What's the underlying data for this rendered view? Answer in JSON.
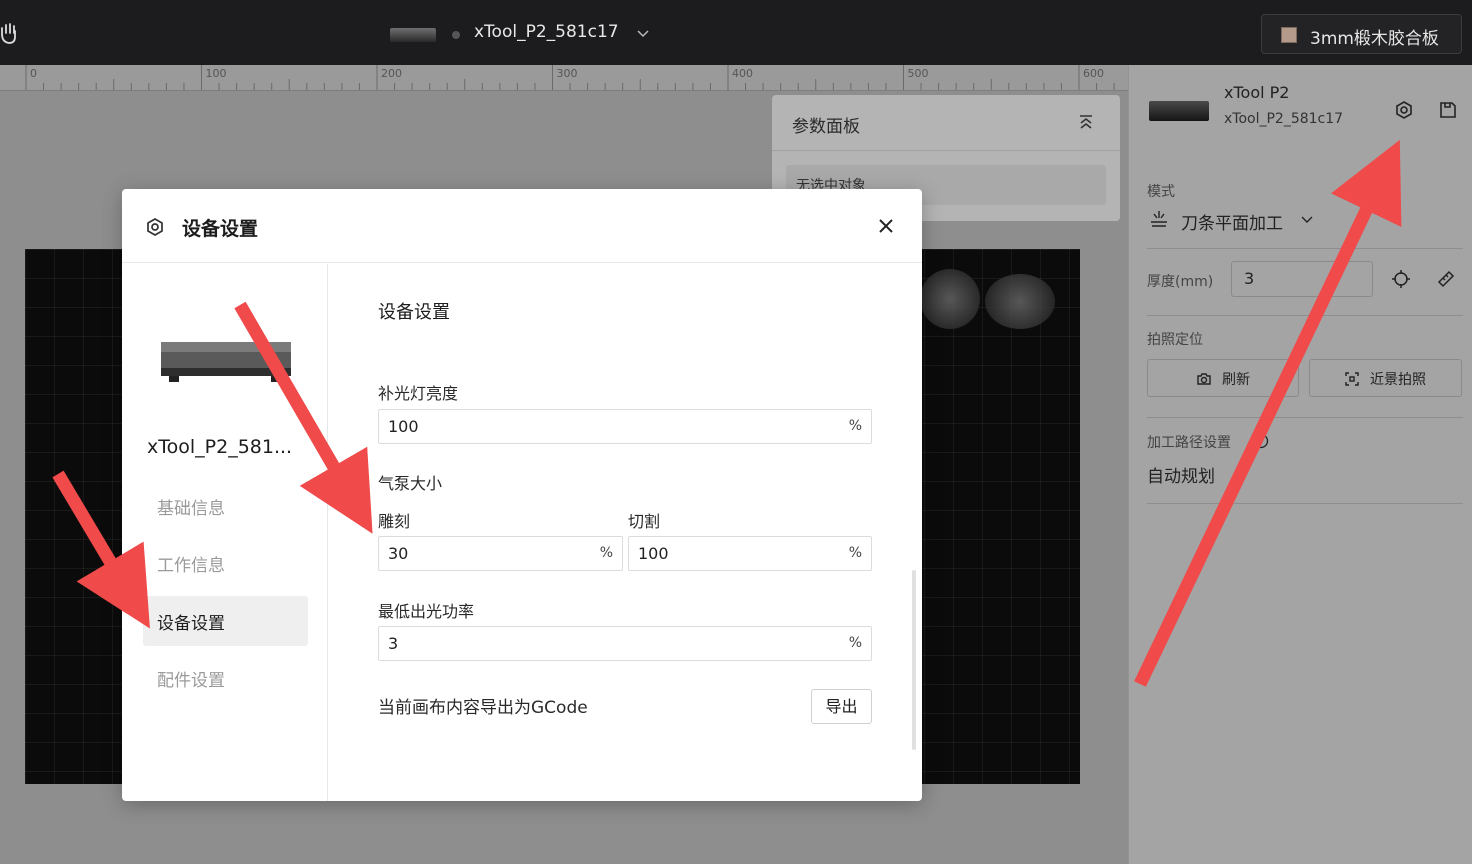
{
  "topbar": {
    "device_name": "xTool_P2_581c17",
    "material": "3mm椴木胶合板"
  },
  "ruler": {
    "ticks": [
      "0",
      "100",
      "200",
      "300",
      "400",
      "500",
      "600"
    ]
  },
  "param_panel": {
    "title": "参数面板",
    "empty_text": "无选中对象"
  },
  "sidebar": {
    "model": "xTool P2",
    "device_id": "xTool_P2_581c17",
    "mode_label": "模式",
    "mode_value": "刀条平面加工",
    "thickness_label": "厚度(mm)",
    "thickness_value": "3",
    "photo_label": "拍照定位",
    "refresh_label": "刷新",
    "closeup_label": "近景拍照",
    "path_label": "加工路径设置",
    "path_value": "自动规划"
  },
  "modal": {
    "title": "设备设置",
    "device_name": "xTool_P2_581...",
    "nav": [
      {
        "label": "基础信息"
      },
      {
        "label": "工作信息"
      },
      {
        "label": "设备设置"
      },
      {
        "label": "配件设置"
      }
    ],
    "section_title": "设备设置",
    "fill_light": {
      "label": "补光灯亮度",
      "value": "100",
      "unit": "%"
    },
    "air_pump": {
      "label": "气泵大小",
      "engrave_label": "雕刻",
      "engrave_value": "30",
      "cut_label": "切割",
      "cut_value": "100",
      "unit": "%"
    },
    "min_power": {
      "label": "最低出光功率",
      "value": "3",
      "unit": "%"
    },
    "export": {
      "label": "当前画布内容导出为GCode",
      "button": "导出"
    }
  },
  "colors": {
    "arrow": "#f04a4a",
    "topbar": "#1c1c1e"
  }
}
